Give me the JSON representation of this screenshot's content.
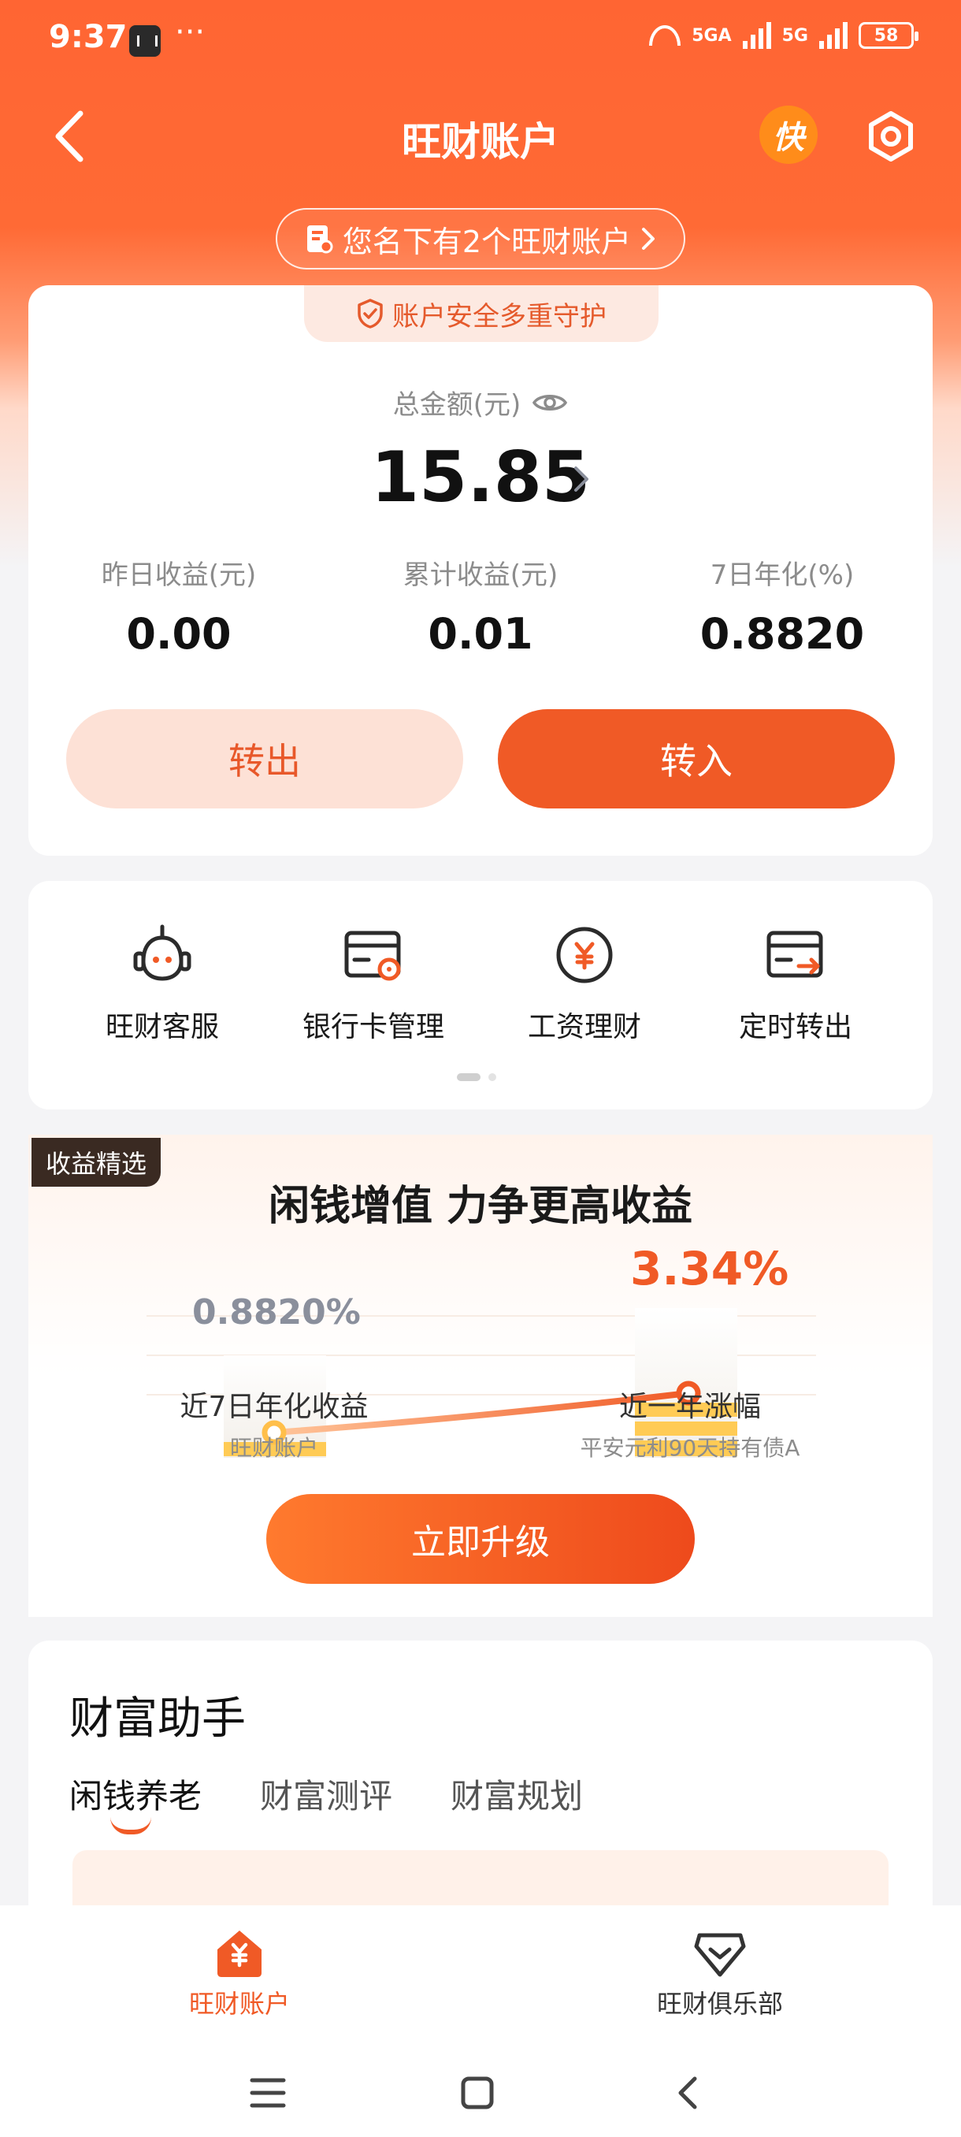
{
  "status_bar": {
    "time": "9:37",
    "dots": "···",
    "net1": "5GA",
    "net2": "5G",
    "battery": "58"
  },
  "header": {
    "title": "旺财账户",
    "kuai_label": "快",
    "account_notice": "您名下有2个旺财账户"
  },
  "account_card": {
    "safety": "账户安全多重守护",
    "total_label": "总金额(元)",
    "total_value": "15.85",
    "stats": [
      {
        "label": "昨日收益(元)",
        "value": "0.00"
      },
      {
        "label": "累计收益(元)",
        "value": "0.01"
      },
      {
        "label": "7日年化(%)",
        "value": "0.8820"
      }
    ],
    "transfer_out": "转出",
    "transfer_in": "转入"
  },
  "tools": [
    {
      "label": "旺财客服",
      "icon": "robot-service-icon"
    },
    {
      "label": "银行卡管理",
      "icon": "bank-card-icon"
    },
    {
      "label": "工资理财",
      "icon": "yuan-coin-icon"
    },
    {
      "label": "定时转出",
      "icon": "scheduled-transfer-icon"
    }
  ],
  "promo": {
    "tag": "收益精选",
    "title": "闲钱增值 力争更高收益",
    "left": {
      "value": "0.8820%",
      "caption": "近7日年化收益",
      "sub": "旺财账户"
    },
    "right": {
      "value": "3.34%",
      "caption": "近一年涨幅",
      "sub": "平安元利90天持有债A"
    },
    "cta": "立即升级"
  },
  "wealth": {
    "title": "财富助手",
    "tabs": [
      "闲钱养老",
      "财富测评",
      "财富规划"
    ],
    "active_tab": 0
  },
  "tabbar": {
    "items": [
      {
        "label": "旺财账户",
        "icon": "home-yuan-icon",
        "active": true
      },
      {
        "label": "旺财俱乐部",
        "icon": "diamond-icon",
        "active": false
      }
    ]
  },
  "colors": {
    "brand": "#f05a26",
    "header_bg": "#ff6533",
    "inactive_text": "#8c8c8c"
  }
}
